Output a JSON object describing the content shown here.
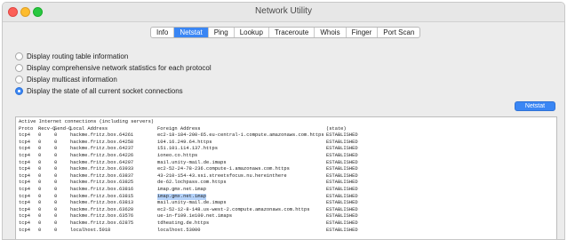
{
  "window": {
    "title": "Network Utility"
  },
  "tabs": [
    {
      "label": "Info",
      "active": false
    },
    {
      "label": "Netstat",
      "active": true
    },
    {
      "label": "Ping",
      "active": false
    },
    {
      "label": "Lookup",
      "active": false
    },
    {
      "label": "Traceroute",
      "active": false
    },
    {
      "label": "Whois",
      "active": false
    },
    {
      "label": "Finger",
      "active": false
    },
    {
      "label": "Port Scan",
      "active": false
    }
  ],
  "options": [
    {
      "label": "Display routing table information",
      "selected": false
    },
    {
      "label": "Display comprehensive network statistics for each protocol",
      "selected": false
    },
    {
      "label": "Display multicast information",
      "selected": false
    },
    {
      "label": "Display the state of all current socket connections",
      "selected": true
    }
  ],
  "netstat_button": "Netstat",
  "output": {
    "header_line": "Active Internet connections (including servers)",
    "columns": {
      "proto": "Proto",
      "recv": "Recv-Q",
      "send": "Send-Q",
      "local": "Local Address",
      "foreign": "Foreign Address",
      "state": "(state)"
    },
    "rows": [
      {
        "proto": "tcp4",
        "recv": "0",
        "send": "0",
        "local": "hackme.fritz.box.64261",
        "foreign": "ec2-18-184-200-65.eu-central-1.compute.amazonaws.com.https",
        "state": "ESTABLISHED"
      },
      {
        "proto": "tcp4",
        "recv": "0",
        "send": "0",
        "local": "hackme.fritz.box.64258",
        "foreign": "104.16.249.64.https",
        "state": "ESTABLISHED"
      },
      {
        "proto": "tcp4",
        "recv": "0",
        "send": "0",
        "local": "hackme.fritz.box.64237",
        "foreign": "151.101.114.137.https",
        "state": "ESTABLISHED"
      },
      {
        "proto": "tcp4",
        "recv": "0",
        "send": "0",
        "local": "hackme.fritz.box.64226",
        "foreign": "ioneo.co.https",
        "state": "ESTABLISHED"
      },
      {
        "proto": "tcp4",
        "recv": "0",
        "send": "0",
        "local": "hackme.fritz.box.64207",
        "foreign": "mail.unity-mail.de.imaps",
        "state": "ESTABLISHED"
      },
      {
        "proto": "tcp4",
        "recv": "0",
        "send": "0",
        "local": "hackme.fritz.box.63933",
        "foreign": "ec2-52-24-78-236.compute-1.amazonaws.com.https",
        "state": "ESTABLISHED"
      },
      {
        "proto": "tcp4",
        "recv": "0",
        "send": "0",
        "local": "hackme.fritz.box.63837",
        "foreign": "43-210-154-43.ssi.streetsfocus.nu.hereinthere",
        "state": "ESTABLISHED"
      },
      {
        "proto": "tcp4",
        "recv": "0",
        "send": "0",
        "local": "hackme.fritz.box.63825",
        "foreign": "de-62.lochpass.com.https",
        "state": "ESTABLISHED"
      },
      {
        "proto": "tcp4",
        "recv": "0",
        "send": "0",
        "local": "hackme.fritz.box.63816",
        "foreign": "imap.gmx.net.imap",
        "state": "ESTABLISHED"
      },
      {
        "proto": "tcp4",
        "recv": "0",
        "send": "0",
        "local": "hackme.fritz.box.63815",
        "foreign": "imap.gmx.net.imap",
        "state": "ESTABLISHED",
        "highlight": true
      },
      {
        "proto": "tcp4",
        "recv": "0",
        "send": "0",
        "local": "hackme.fritz.box.63813",
        "foreign": "mail.unity-mail.de.imaps",
        "state": "ESTABLISHED"
      },
      {
        "proto": "tcp4",
        "recv": "0",
        "send": "0",
        "local": "hackme.fritz.box.63620",
        "foreign": "ec2-52-12-8-148.us-west-2.compute.amazonaws.com.https",
        "state": "ESTABLISHED"
      },
      {
        "proto": "tcp4",
        "recv": "0",
        "send": "0",
        "local": "hackme.fritz.box.63576",
        "foreign": "ue-in-f109.1e100.net.imaps",
        "state": "ESTABLISHED"
      },
      {
        "proto": "tcp4",
        "recv": "0",
        "send": "0",
        "local": "hackme.fritz.box.62875",
        "foreign": "tdheating.de.https",
        "state": "ESTABLISHED"
      },
      {
        "proto": "tcp4",
        "recv": "0",
        "send": "0",
        "local": "localhost.5918",
        "foreign": "localhost.53000",
        "state": "ESTABLISHED"
      }
    ]
  }
}
